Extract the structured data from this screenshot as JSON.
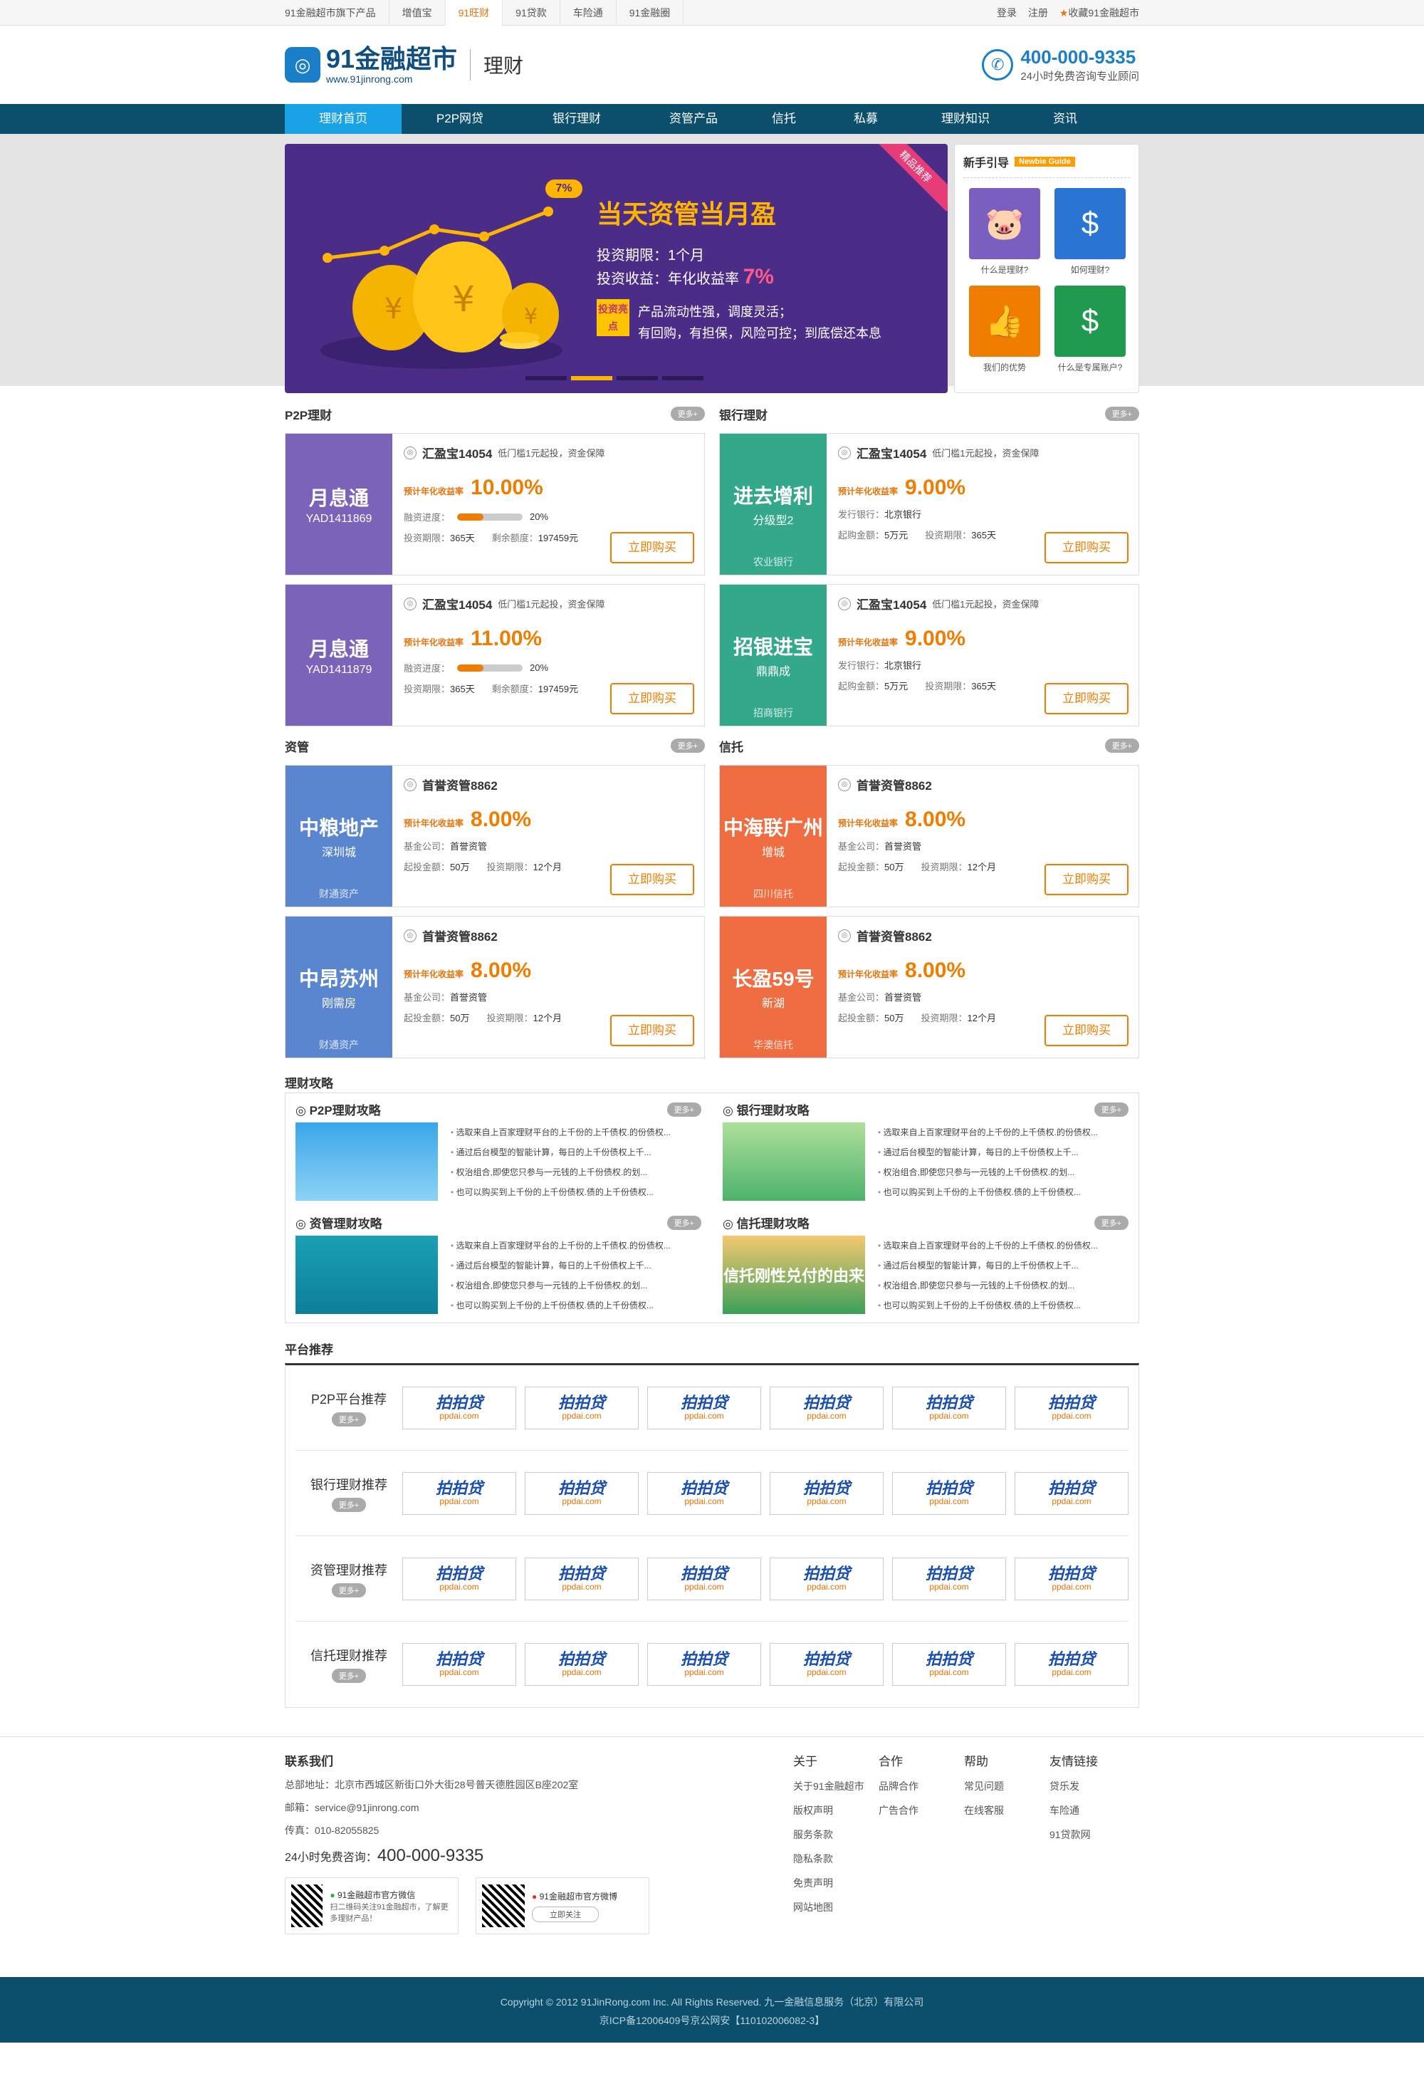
{
  "topbar": {
    "items": [
      "91金融超市旗下产品",
      "增值宝",
      "91旺财",
      "91贷款",
      "车险通",
      "91金融圈"
    ],
    "login": "登录",
    "register": "注册",
    "fav": "收藏91金融超市"
  },
  "header": {
    "logo_name": "91金融超市",
    "logo_url": "www.91jinrong.com",
    "section": "理财",
    "phone": "400-000-9335",
    "phone_sub": "24小时免费咨询专业顾问"
  },
  "nav": [
    "理财首页",
    "P2P网贷",
    "银行理财",
    "资管产品",
    "信托",
    "私募",
    "理财知识",
    "资讯"
  ],
  "banner": {
    "ribbon": "精品推荐",
    "title": "当天资管当月盈",
    "pct": "7%",
    "l1": "投资期限：1个月",
    "l2_prefix": "投资收益：年化收益率",
    "l2_value": "7%",
    "hl": "投资亮点",
    "l3": "产品流动性强，调度灵活；",
    "l4": "有回购，有担保，风险可控；到底偿还本息"
  },
  "guide": {
    "title": "新手引导",
    "tag": "Newbie Guide",
    "items": [
      "什么是理财?",
      "如何理财?",
      "我们的优势",
      "什么是专属账户?"
    ]
  },
  "more": "更多+",
  "sections": [
    {
      "title": "P2P理财",
      "cards": [
        {
          "pic_big": "月息通",
          "pic_small": "YAD1411869",
          "pic_foot": "",
          "name": "汇盈宝14054",
          "desc": "低门槛1元起投，资金保障",
          "rate_label": "预计年化收益率",
          "rate": "10.00%",
          "l1": "融资进度：",
          "l1v": "20%",
          "l2": "投资期限：",
          "l2v": "365天",
          "l3": "剩余额度：",
          "l3v": "197459元",
          "buy": "立即购买"
        },
        {
          "pic_big": "月息通",
          "pic_small": "YAD1411879",
          "pic_foot": "",
          "name": "汇盈宝14054",
          "desc": "低门槛1元起投，资金保障",
          "rate_label": "预计年化收益率",
          "rate": "11.00%",
          "l1": "融资进度：",
          "l1v": "20%",
          "l2": "投资期限：",
          "l2v": "365天",
          "l3": "剩余额度：",
          "l3v": "197459元",
          "buy": "立即购买"
        }
      ]
    },
    {
      "title": "银行理财",
      "cards": [
        {
          "pic_big": "进去增利",
          "pic_small": "分级型2",
          "pic_foot": "农业银行",
          "name": "汇盈宝14054",
          "desc": "低门槛1元起投，资金保障",
          "rate_label": "预计年化收益率",
          "rate": "9.00%",
          "l1": "发行银行：",
          "l1v": "北京银行",
          "l2": "起购金额：",
          "l2v": "5万元",
          "l3": "投资期限：",
          "l3v": "365天",
          "buy": "立即购买"
        },
        {
          "pic_big": "招银进宝",
          "pic_small": "鼎鼎成",
          "pic_foot": "招商银行",
          "name": "汇盈宝14054",
          "desc": "低门槛1元起投，资金保障",
          "rate_label": "预计年化收益率",
          "rate": "9.00%",
          "l1": "发行银行：",
          "l1v": "北京银行",
          "l2": "起购金额：",
          "l2v": "5万元",
          "l3": "投资期限：",
          "l3v": "365天",
          "buy": "立即购买"
        }
      ]
    },
    {
      "title": "资管",
      "cards": [
        {
          "pic_big": "中粮地产",
          "pic_small": "深圳城",
          "pic_foot": "财通资产",
          "name": "首誉资管8862",
          "desc": "",
          "rate_label": "预计年化收益率",
          "rate": "8.00%",
          "l1": "基金公司：",
          "l1v": "首誉资管",
          "l2": "起投金额：",
          "l2v": "50万",
          "l3": "投资期限：",
          "l3v": "12个月",
          "buy": "立即购买"
        },
        {
          "pic_big": "中昂苏州",
          "pic_small": "刚需房",
          "pic_foot": "财通资产",
          "name": "首誉资管8862",
          "desc": "",
          "rate_label": "预计年化收益率",
          "rate": "8.00%",
          "l1": "基金公司：",
          "l1v": "首誉资管",
          "l2": "起投金额：",
          "l2v": "50万",
          "l3": "投资期限：",
          "l3v": "12个月",
          "buy": "立即购买"
        }
      ]
    },
    {
      "title": "信托",
      "cards": [
        {
          "pic_big": "中海联广州",
          "pic_small": "增城",
          "pic_foot": "四川信托",
          "name": "首誉资管8862",
          "desc": "",
          "rate_label": "预计年化收益率",
          "rate": "8.00%",
          "l1": "基金公司：",
          "l1v": "首誉资管",
          "l2": "起投金额：",
          "l2v": "50万",
          "l3": "投资期限：",
          "l3v": "12个月",
          "buy": "立即购买"
        },
        {
          "pic_big": "长盈59号",
          "pic_small": "新湖",
          "pic_foot": "华澳信托",
          "name": "首誉资管8862",
          "desc": "",
          "rate_label": "预计年化收益率",
          "rate": "8.00%",
          "l1": "基金公司：",
          "l1v": "首誉资管",
          "l2": "起投金额：",
          "l2v": "50万",
          "l3": "投资期限：",
          "l3v": "12个月",
          "buy": "立即购买"
        }
      ]
    }
  ],
  "strategy": {
    "title": "理财攻略",
    "blocks": [
      {
        "title": "P2P理财攻略",
        "items": [
          "选取来自上百家理财平台的上千份的上千债权.的份债权...",
          "通过后台模型的智能计算，每日的上千份债权上千...",
          "权治组合,即使您只参与一元钱的上千份债权.的划...",
          "也可以购买到上千份的上千份债权.债的上千份债权..."
        ]
      },
      {
        "title": "银行理财攻略",
        "items": [
          "选取来自上百家理财平台的上千份的上千债权.的份债权...",
          "通过后台模型的智能计算，每日的上千份债权上千...",
          "权治组合,即使您只参与一元钱的上千份债权.的划...",
          "也可以购买到上千份的上千份债权.债的上千份债权..."
        ]
      },
      {
        "title": "资管理财攻略",
        "items": [
          "选取来自上百家理财平台的上千份的上千债权.的份债权...",
          "通过后台模型的智能计算，每日的上千份债权上千...",
          "权治组合,即使您只参与一元钱的上千份债权.的划...",
          "也可以购买到上千份的上千份债权.债的上千份债权..."
        ]
      },
      {
        "title": "信托理财攻略",
        "img_text": "信托刚性兑付的由来",
        "items": [
          "选取来自上百家理财平台的上千份的上千债权.的份债权...",
          "通过后台模型的智能计算，每日的上千份债权上千...",
          "权治组合,即使您只参与一元钱的上千份债权.的划...",
          "也可以购买到上千份的上千份债权.债的上千份债权..."
        ]
      }
    ]
  },
  "platform": {
    "title": "平台推荐",
    "rows": [
      "P2P平台推荐",
      "银行理财推荐",
      "资管理财推荐",
      "信托理财推荐"
    ],
    "logo_name": "拍拍贷",
    "logo_domain": "ppdai.com"
  },
  "footer": {
    "contact_title": "联系我们",
    "address": "总部地址：北京市西城区新街口外大街28号普天德胜园区B座202室",
    "email": "邮箱：service@91jinrong.com",
    "fax": "传真：010-82055825",
    "hotline_label": "24小时免费咨询：",
    "hotline": "400-000-9335",
    "wechat_title": "91金融超市官方微信",
    "wechat_sub": "扫二维码关注91金融超市，了解更多理财产品！",
    "weibo_title": "91金融超市官方微博",
    "weibo_btn": "立即关注",
    "cols": [
      {
        "h": "关于",
        "items": [
          "关于91金融超市",
          "版权声明",
          "服务条款",
          "隐私条款",
          "免责声明",
          "网站地图"
        ]
      },
      {
        "h": "合作",
        "items": [
          "品牌合作",
          "广告合作"
        ]
      },
      {
        "h": "帮助",
        "items": [
          "常见问题",
          "在线客服"
        ]
      },
      {
        "h": "友情链接",
        "items": [
          "贷乐发",
          "车险通",
          "91贷款网"
        ]
      }
    ],
    "copyright": "Copyright © 2012 91JinRong.com Inc. All Rights Reserved. 九一金融信息服务（北京）有限公司",
    "icp": "京ICP备12006409号京公网安【110102006082-3】"
  },
  "colors": {
    "nav": "#0c4f6c",
    "accent": "#f07d00",
    "p2p": "#7a63b8",
    "bank": "#34a88a",
    "asset": "#5a85cf",
    "trust": "#ef6d41"
  }
}
